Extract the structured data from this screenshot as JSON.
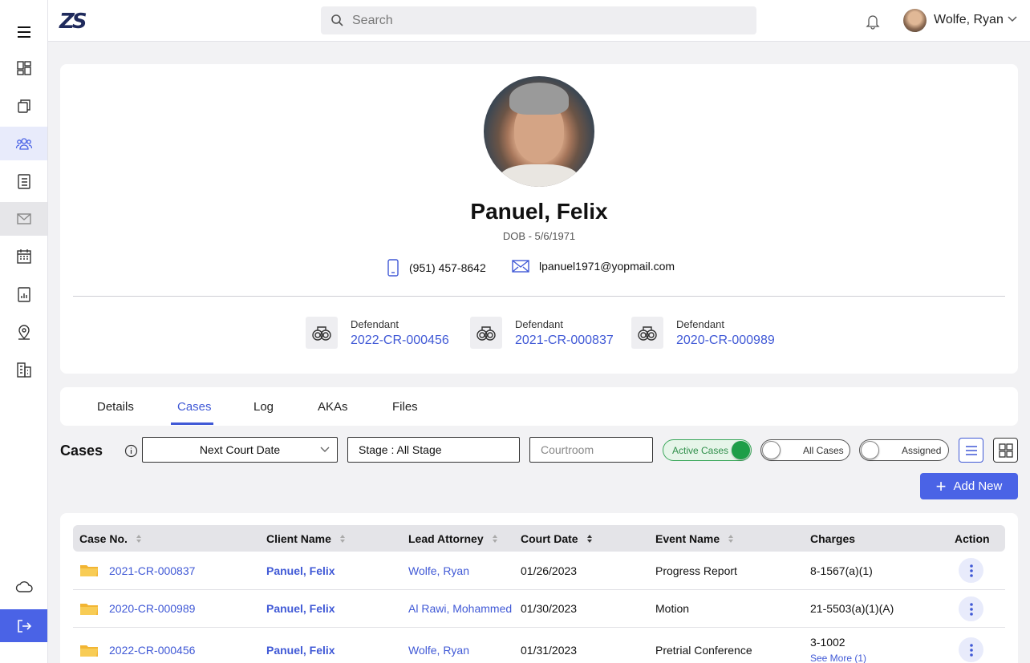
{
  "app": {
    "logo": "ZS"
  },
  "search": {
    "placeholder": "Search"
  },
  "user": {
    "name": "Wolfe, Ryan"
  },
  "sidebar": {
    "items": [
      {
        "icon": "menu-icon"
      },
      {
        "icon": "dashboard-icon"
      },
      {
        "icon": "copy-icon"
      },
      {
        "icon": "people-icon"
      },
      {
        "icon": "checklist-icon"
      },
      {
        "icon": "mail-icon"
      },
      {
        "icon": "calendar-icon"
      },
      {
        "icon": "report-icon"
      },
      {
        "icon": "location-icon"
      },
      {
        "icon": "building-icon"
      },
      {
        "icon": "cloud-icon"
      },
      {
        "icon": "logout-icon"
      }
    ]
  },
  "profile": {
    "name": "Panuel, Felix",
    "dob": "DOB - 5/6/1971",
    "phone": "(951) 457-8642",
    "email": "lpanuel1971@yopmail.com",
    "roles": [
      {
        "role": "Defendant",
        "case": "2022-CR-000456"
      },
      {
        "role": "Defendant",
        "case": "2021-CR-000837"
      },
      {
        "role": "Defendant",
        "case": "2020-CR-000989"
      }
    ]
  },
  "tabs": [
    {
      "label": "Details"
    },
    {
      "label": "Cases"
    },
    {
      "label": "Log"
    },
    {
      "label": "AKAs"
    },
    {
      "label": "Files"
    }
  ],
  "cases": {
    "title": "Cases",
    "filters": {
      "sort": "Next Court Date",
      "stage": "Stage :  All Stage",
      "courtroom_placeholder": "Courtroom"
    },
    "toggles": {
      "active": {
        "label": "Active Cases",
        "on": true
      },
      "all": {
        "label": "All Cases",
        "on": false
      },
      "assigned": {
        "label": "Assigned",
        "on": false
      }
    },
    "add_label": "Add New",
    "columns": [
      "Case No.",
      "Client Name",
      "Lead Attorney",
      "Court Date",
      "Event Name",
      "Charges",
      "Action"
    ],
    "rows": [
      {
        "case_no": "2021-CR-000837",
        "client": "Panuel, Felix",
        "attorney": "Wolfe, Ryan",
        "court_date": "01/26/2023",
        "event": "Progress Report",
        "charges": "8-1567(a)(1)",
        "see_more": ""
      },
      {
        "case_no": "2020-CR-000989",
        "client": "Panuel, Felix",
        "attorney": "Al Rawi, Mohammed",
        "court_date": "01/30/2023",
        "event": "Motion",
        "charges": "21-5503(a)(1)(A)",
        "see_more": ""
      },
      {
        "case_no": "2022-CR-000456",
        "client": "Panuel, Felix",
        "attorney": "Wolfe, Ryan",
        "court_date": "01/31/2023",
        "event": "Pretrial Conference",
        "charges": "3-1002",
        "see_more": "See More (1)"
      }
    ]
  },
  "colors": {
    "accent": "#4a63e6",
    "link": "#4059d6",
    "toggle_on": "#1e9e48"
  }
}
